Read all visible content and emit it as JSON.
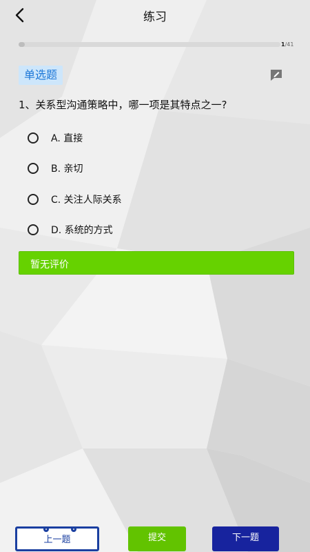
{
  "header": {
    "title": "练习"
  },
  "progress": {
    "current": "1",
    "total": "/41",
    "fraction": 0.024
  },
  "question": {
    "type_label": "单选题",
    "text": "1、关系型沟通策略中，哪一项是其特点之一?",
    "options": [
      {
        "label": "A. 直接"
      },
      {
        "label": "B. 亲切"
      },
      {
        "label": "C. 关注人际关系"
      },
      {
        "label": "D. 系统的方式"
      }
    ]
  },
  "review": {
    "label": "暂无评价"
  },
  "footer": {
    "prev_label": "上一题",
    "submit_label": "提交",
    "next_label": "下一题"
  },
  "colors": {
    "accent_blue": "#1e78d8",
    "review_green": "#66d200",
    "submit_green": "#62c300",
    "navy": "#17239e"
  },
  "icons": {
    "back": "chevron-left-icon",
    "edit": "edit-note-icon"
  }
}
